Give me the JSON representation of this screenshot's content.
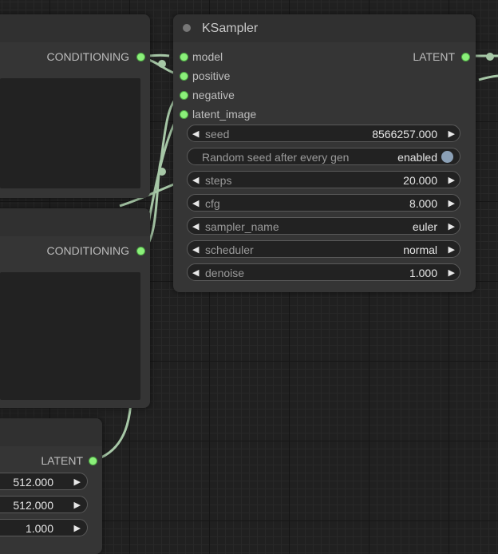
{
  "node_top": {
    "output_label": "CONDITIONING"
  },
  "node_middle": {
    "output_label": "CONDITIONING"
  },
  "node_bottom": {
    "output_label": "LATENT",
    "widgets": [
      {
        "value": "512.000"
      },
      {
        "value": "512.000"
      },
      {
        "value": "1.000"
      }
    ]
  },
  "ksampler": {
    "title": "KSampler",
    "inputs": [
      "model",
      "positive",
      "negative",
      "latent_image"
    ],
    "output_label": "LATENT",
    "seed": {
      "label": "seed",
      "value": "8566257.000"
    },
    "random_seed": {
      "label": "Random seed after every gen",
      "value": "enabled"
    },
    "steps": {
      "label": "steps",
      "value": "20.000"
    },
    "cfg": {
      "label": "cfg",
      "value": "8.000"
    },
    "sampler_name": {
      "label": "sampler_name",
      "value": "euler"
    },
    "scheduler": {
      "label": "scheduler",
      "value": "normal"
    },
    "denoise": {
      "label": "denoise",
      "value": "1.000"
    }
  },
  "colors": {
    "canvas": "#202020",
    "node_body": "#353535",
    "port": "#8bf07a",
    "wire": "#a7c8a7"
  }
}
